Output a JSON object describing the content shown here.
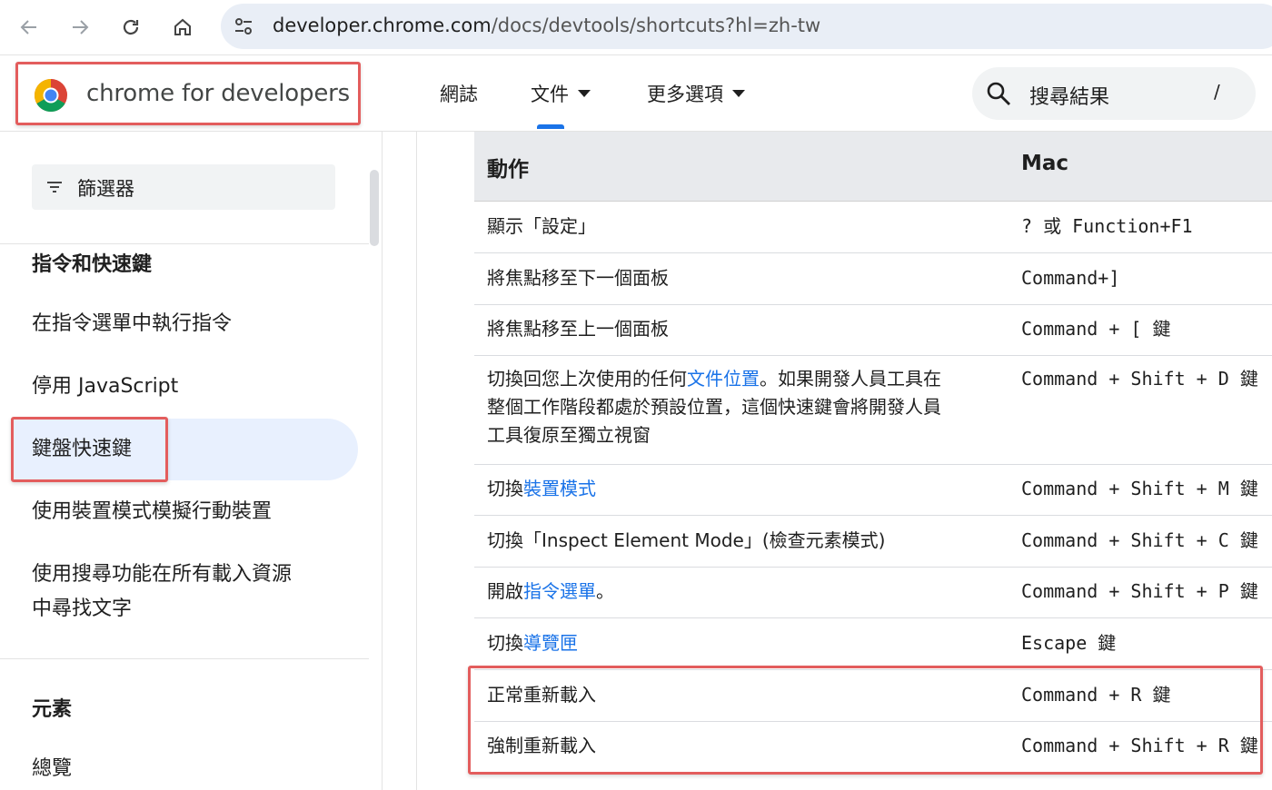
{
  "browser": {
    "url_host": "developer.chrome.com",
    "url_path": "/docs/devtools/shortcuts?hl=zh-tw"
  },
  "header": {
    "brand": "chrome for developers",
    "nav": [
      {
        "label": "網誌"
      },
      {
        "label": "文件"
      },
      {
        "label": "更多選項"
      }
    ],
    "search_placeholder": "搜尋結果",
    "search_shortcut": "/"
  },
  "sidebar": {
    "filter_label": "篩選器",
    "section1_title": "指令和快速鍵",
    "items": [
      "在指令選單中執行指令",
      "停用 JavaScript",
      "鍵盤快速鍵",
      "使用裝置模式模擬行動裝置",
      "使用搜尋功能在所有載入資源",
      "中尋找文字"
    ],
    "section2_title": "元素",
    "section2_items": [
      "總覽"
    ]
  },
  "table": {
    "col_action": "動作",
    "col_mac": "Mac",
    "rows": [
      {
        "action": "顯示「設定」",
        "mac": "? 或 Function+F1"
      },
      {
        "action": "將焦點移至下一個面板",
        "mac": "Command+]"
      },
      {
        "action": "將焦點移至上一個面板",
        "mac": "Command + [ 鍵"
      },
      {
        "action_pre": "切換回您上次使用的任何",
        "action_link": "文件位置",
        "action_post": "。如果開發人員工具在",
        "action_line2": "整個工作階段都處於預設位置，這個快速鍵會將開發人員",
        "action_line3": "工具復原至獨立視窗",
        "mac": "Command + Shift + D 鍵"
      },
      {
        "action_pre": "切換",
        "action_link": "裝置模式",
        "mac": "Command + Shift + M 鍵"
      },
      {
        "action": "切換「Inspect Element Mode」(檢查元素模式)",
        "mac": "Command + Shift + C 鍵"
      },
      {
        "action_pre": "開啟",
        "action_link": "指令選單",
        "action_post": "。",
        "mac": "Command + Shift + P 鍵"
      },
      {
        "action_pre": "切換",
        "action_link": "導覽匣",
        "mac": "Escape  鍵"
      },
      {
        "action": "正常重新載入",
        "mac": "Command + R 鍵"
      },
      {
        "action": "強制重新載入",
        "mac": "Command + Shift + R 鍵"
      }
    ]
  }
}
